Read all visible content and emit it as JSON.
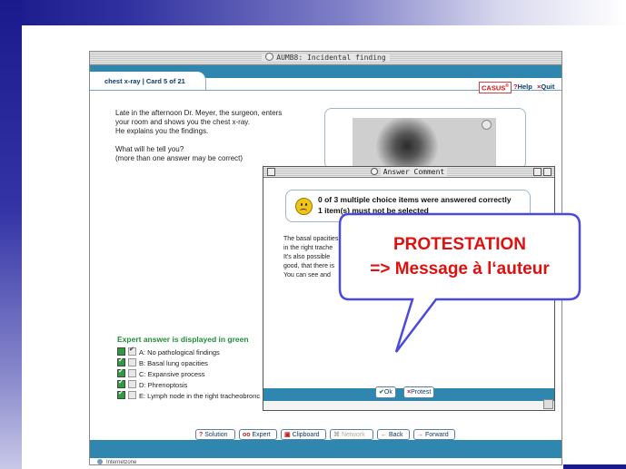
{
  "window": {
    "title": "AUMB8: Incidental finding"
  },
  "card": {
    "tab_label": "chest x-ray | Card 5 of 21"
  },
  "header": {
    "logo": "CASUS",
    "logo_mark": "®",
    "help_icon": "?",
    "help_label": "Help",
    "quit_icon": "×",
    "quit_label": "Quit"
  },
  "narrative": {
    "line1": "Late in the afternoon Dr. Meyer, the surgeon, enters",
    "line2": "your room and shows you the chest x-ray.",
    "line3": "He explains you the findings.",
    "line4": "What will he tell you?",
    "line5": "(more than one answer may be correct)"
  },
  "expert": {
    "title": "Expert answer is displayed in green",
    "choices": [
      {
        "label": "A: No pathological findings",
        "expert": false,
        "user": true
      },
      {
        "label": "B: Basal lung opacities",
        "expert": true,
        "user": false
      },
      {
        "label": "C: Expansive process",
        "expert": true,
        "user": false
      },
      {
        "label": "D: Phrenoptosis",
        "expert": true,
        "user": false
      },
      {
        "label": "E: Lymph node in the right tracheobronc",
        "expert": true,
        "user": false
      }
    ]
  },
  "nav": {
    "solution_icon": "?",
    "solution": "Solution",
    "expert_icon": "oo",
    "expert": "Expert",
    "clipboard_icon": "▣",
    "clipboard": "Clipboard",
    "network_icon": "⌘",
    "network": "Network",
    "back_icon": "←",
    "back": "Back",
    "forward_icon": "→",
    "forward": "Forward"
  },
  "status": {
    "label": "Internetzone"
  },
  "dialog": {
    "title": "Answer Comment",
    "result_line1": "0 of 3 multiple choice items were answered correctly",
    "result_line2": "1 item(s) must not be selected",
    "explanation": {
      "line1": "The basal opacities",
      "line2": "in the right trache",
      "line3": "It's also possible",
      "line4": "good, that there is",
      "line5": "You can see and"
    },
    "ok_icon": "✔",
    "ok": "Ok",
    "protest_icon": "×",
    "protest": "Protest"
  },
  "callout": {
    "line1": "PROTESTATION",
    "line2": "=> Message à l‘auteur"
  },
  "colors": {
    "accent_blue": "#2f86ae",
    "expert_green": "#1f8f3a",
    "callout_red": "#e01010",
    "callout_border": "#4a4ae0",
    "slide_band": "#1a1a8c"
  }
}
